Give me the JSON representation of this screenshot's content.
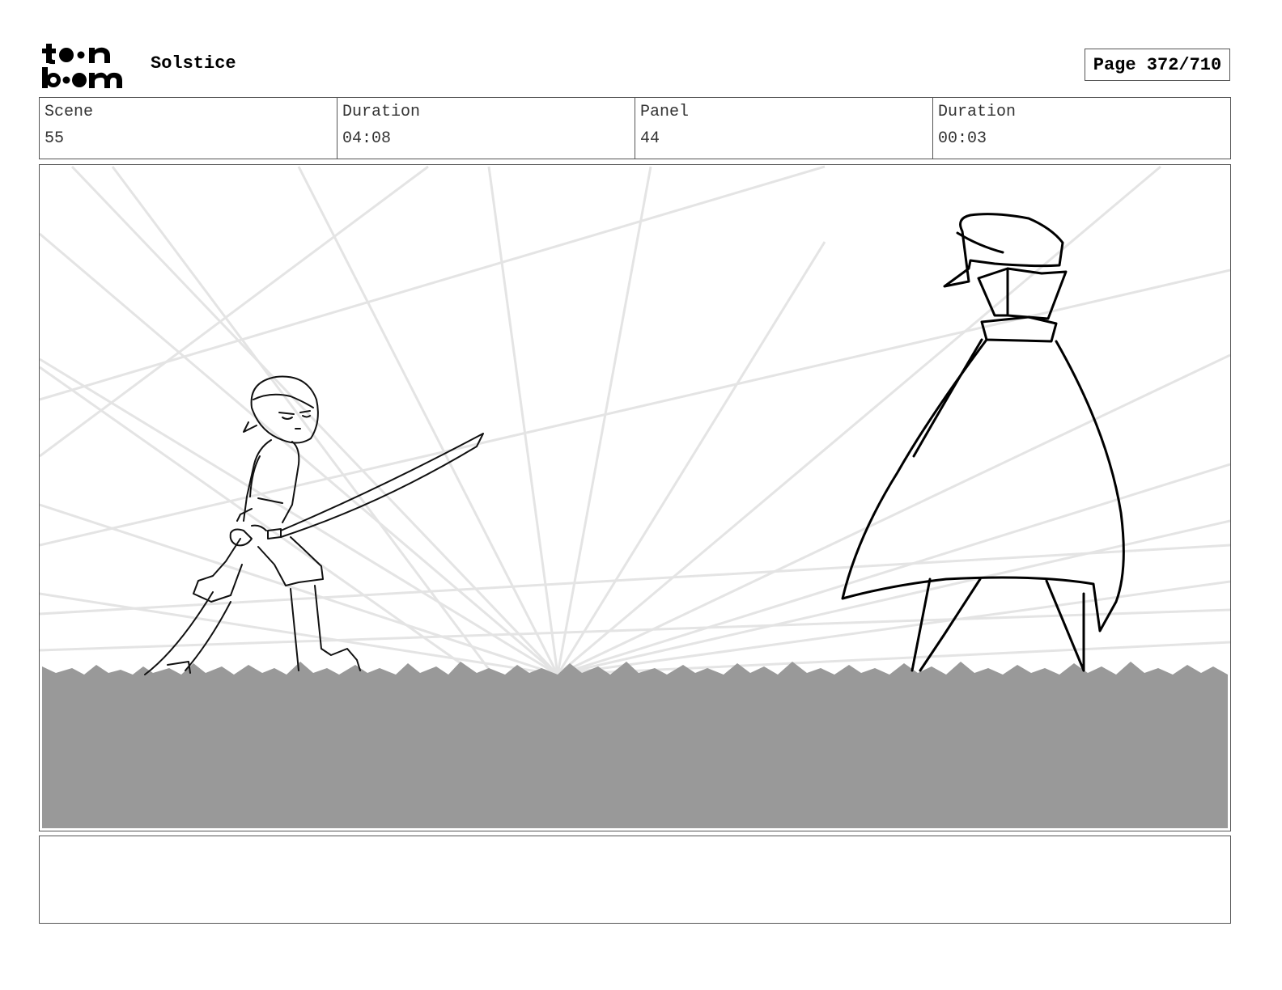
{
  "header": {
    "logo_text": "toonboom",
    "project_title": "Solstice",
    "page_label": "Page 372/710"
  },
  "info": {
    "scene_label": "Scene",
    "scene_value": "55",
    "scene_duration_label": "Duration",
    "scene_duration_value": "04:08",
    "panel_label": "Panel",
    "panel_value": "44",
    "panel_duration_label": "Duration",
    "panel_duration_value": "00:03"
  },
  "notes": {
    "text": ""
  },
  "colors": {
    "ground": "#999999",
    "speed_lines": "#e4e4e4",
    "ink": "#111111"
  }
}
